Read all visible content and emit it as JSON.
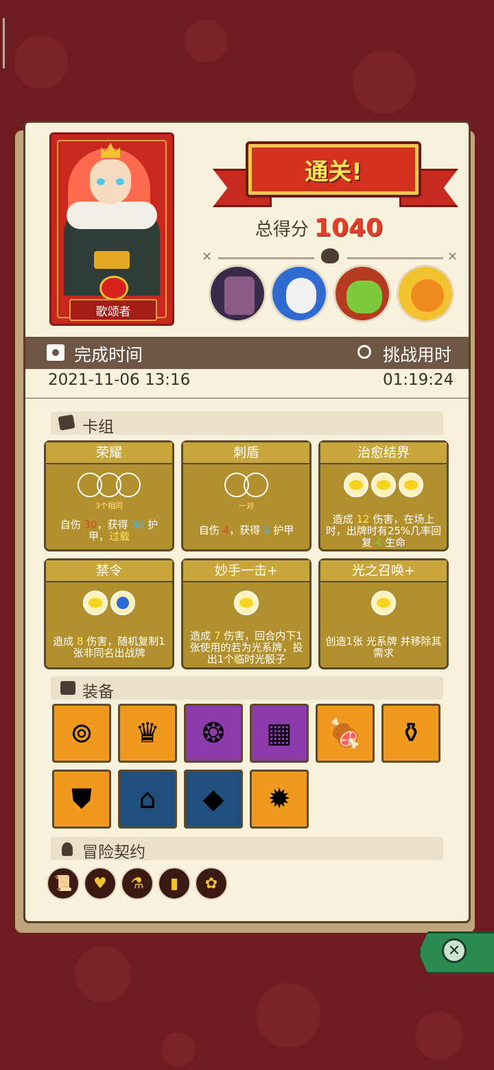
{
  "hero": {
    "name": "歌颂者"
  },
  "result": {
    "title": "通关!",
    "score_label": "总得分",
    "score": "1040"
  },
  "bosses": [
    {
      "icon": "stone-golem-boss-icon"
    },
    {
      "icon": "blue-mask-boss-icon"
    },
    {
      "icon": "green-goblin-king-boss-icon"
    },
    {
      "icon": "sun-pumpkin-boss-icon"
    }
  ],
  "stats": {
    "finish_label": "完成时间",
    "finish_value": "2021-11-06 13:16",
    "duration_label": "挑战用时",
    "duration_value": "01:19:24"
  },
  "deck": {
    "title": "卡组",
    "cards": [
      {
        "title": "荣耀",
        "note": "3个相同",
        "desc": [
          "自伤 ",
          "30",
          "，获得 ",
          "30",
          " 护甲，",
          "过载"
        ]
      },
      {
        "title": "刺盾",
        "note": "一对",
        "desc": [
          "自伤 ",
          "4",
          "，获得 ",
          "9",
          " 护甲"
        ]
      },
      {
        "title": "治愈结界",
        "note": "",
        "desc": [
          "造成 ",
          "12",
          " 伤害，在场上时，出牌时有25%几率回复 ",
          "4",
          " 生命"
        ]
      },
      {
        "title": "禁令",
        "note": "",
        "desc": [
          "造成 ",
          "8",
          " 伤害，随机复制1张非同名出战牌"
        ]
      },
      {
        "title": "妙手一击+",
        "note": "",
        "desc": [
          "造成 ",
          "7",
          " 伤害，回合内下1张使用的若为",
          "光系牌，投出1个临时光骰子"
        ]
      },
      {
        "title": "光之召唤+",
        "note": "",
        "desc": [
          "创造1张 ",
          "光系牌 并移除其需求"
        ]
      }
    ]
  },
  "equipment": {
    "title": "装备",
    "items": [
      {
        "icon": "rune-disc-icon",
        "glyph": "⊚",
        "rarity": "orange"
      },
      {
        "icon": "golden-crown-icon",
        "glyph": "♛",
        "rarity": "orange"
      },
      {
        "icon": "amulet-icon",
        "glyph": "❂",
        "rarity": "purple"
      },
      {
        "icon": "gold-bars-icon",
        "glyph": "▦",
        "rarity": "purple"
      },
      {
        "icon": "ham-icon",
        "glyph": "🍖",
        "rarity": "orange"
      },
      {
        "icon": "vase-icon",
        "glyph": "⚱",
        "rarity": "orange"
      },
      {
        "icon": "ice-shield-icon",
        "glyph": "⛊",
        "rarity": "orange"
      },
      {
        "icon": "war-horn-icon",
        "glyph": "⌂",
        "rarity": "blue"
      },
      {
        "icon": "crystal-icon",
        "glyph": "◆",
        "rarity": "blue"
      },
      {
        "icon": "fire-gem-icon",
        "glyph": "✹",
        "rarity": "orange"
      }
    ]
  },
  "contracts": {
    "title": "冒险契约",
    "items": [
      {
        "icon": "scroll-contract-icon",
        "glyph": "📜"
      },
      {
        "icon": "broken-heart-contract-icon",
        "glyph": "♥"
      },
      {
        "icon": "potion-contract-icon",
        "glyph": "⚗"
      },
      {
        "icon": "dynamite-contract-icon",
        "glyph": "▮"
      },
      {
        "icon": "vine-contract-icon",
        "glyph": "✿"
      }
    ]
  },
  "colors": {
    "accent": "#e2402a",
    "panel": "#f8f1dc",
    "background": "#6e1c20",
    "close": "#2b8a4f"
  }
}
